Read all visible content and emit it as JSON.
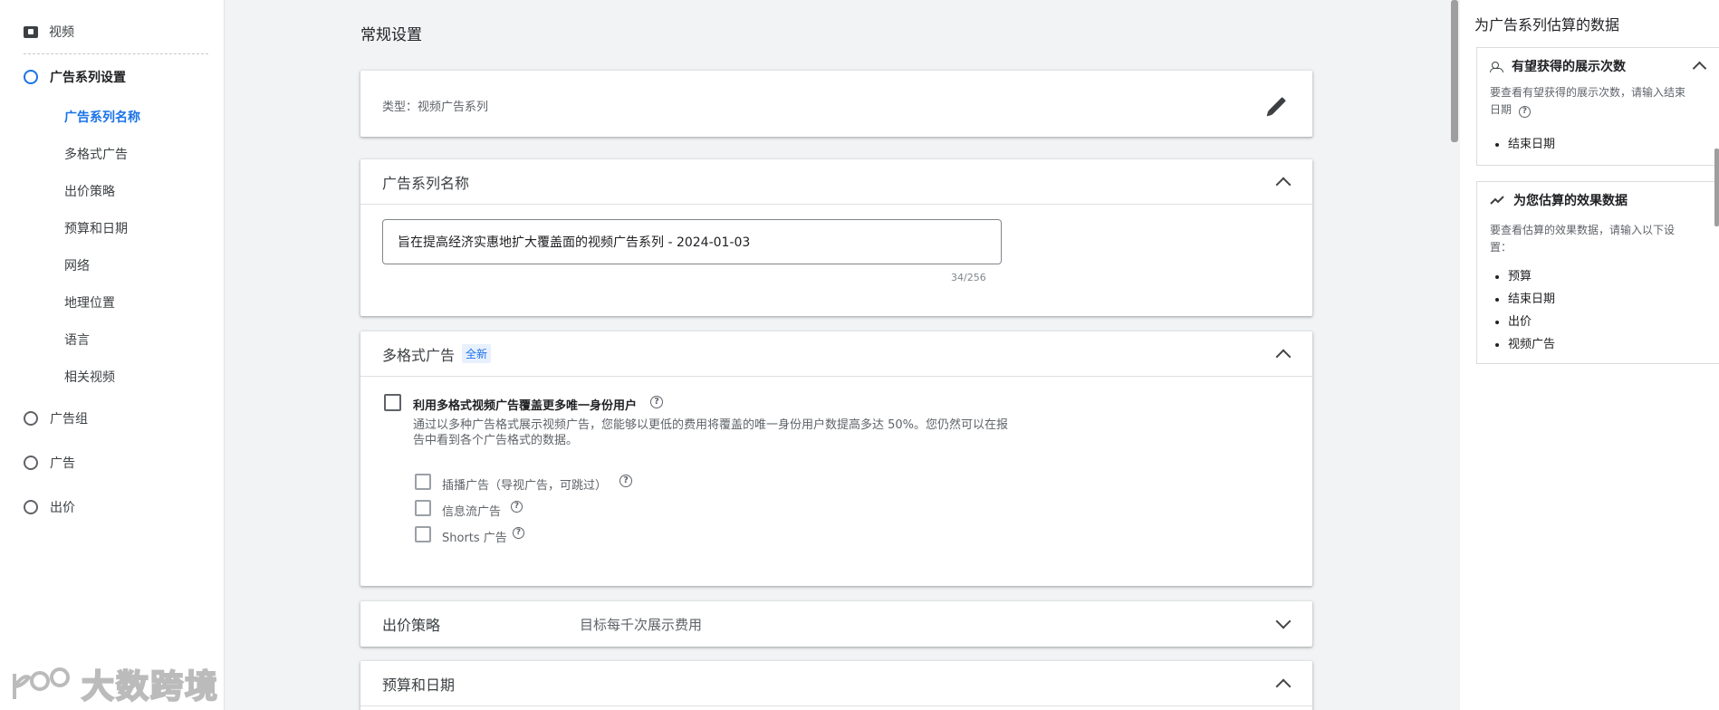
{
  "leftnav": {
    "video_label": "视频",
    "campaign_settings_label": "广告系列设置",
    "sub_items": [
      {
        "label": "广告系列名称",
        "active": true
      },
      {
        "label": "多格式广告",
        "active": false
      },
      {
        "label": "出价策略",
        "active": false
      },
      {
        "label": "预算和日期",
        "active": false
      },
      {
        "label": "网络",
        "active": false
      },
      {
        "label": "地理位置",
        "active": false
      },
      {
        "label": "语言",
        "active": false
      },
      {
        "label": "相关视频",
        "active": false
      }
    ],
    "sections": [
      {
        "label": "广告组"
      },
      {
        "label": "广告"
      },
      {
        "label": "出价"
      }
    ]
  },
  "main": {
    "page_heading": "常规设置",
    "type_card": {
      "label": "类型：视频广告系列",
      "edit_icon": "pencil-icon"
    },
    "name_card": {
      "title": "广告系列名称",
      "input_value": "旨在提高经济实惠地扩大覆盖面的视频广告系列 - 2024-01-03",
      "char_count": "34/256"
    },
    "multiformat_card": {
      "title": "多格式广告",
      "badge": "全新",
      "main_option": "利用多格式视频广告覆盖更多唯一身份用户",
      "description_line1": "通过以多种广告格式展示视频广告，您能够以更低的费用将覆盖的唯一身份用户数提高多达 50%。您仍然可以在报",
      "description_line2": "告中看到各个广告格式的数据。",
      "sub_options": [
        {
          "label": "插播广告（导视广告，可跳过）"
        },
        {
          "label": "信息流广告"
        },
        {
          "label": "Shorts 广告"
        }
      ]
    },
    "bid_card": {
      "title": "出价策略",
      "value": "目标每千次展示费用"
    },
    "budget_card": {
      "title": "预算和日期"
    }
  },
  "rightpanel": {
    "title": "为广告系列估算的数据",
    "impressions_card": {
      "title": "有望获得的展示次数",
      "desc_line1": "要查看有望获得的展示次数，请输入结束",
      "desc_line2": "日期",
      "items": [
        "结束日期"
      ]
    },
    "performance_card": {
      "title": "为您估算的效果数据",
      "desc_line1": "要查看估算的效果数据，请输入以下设",
      "desc_line2": "置：",
      "items": [
        "预算",
        "结束日期",
        "出价",
        "视频广告"
      ]
    }
  },
  "watermark": {
    "text": "大数跨境"
  },
  "colors": {
    "accent": "#1a73e8",
    "background": "#f1f3f4",
    "card": "#ffffff"
  }
}
